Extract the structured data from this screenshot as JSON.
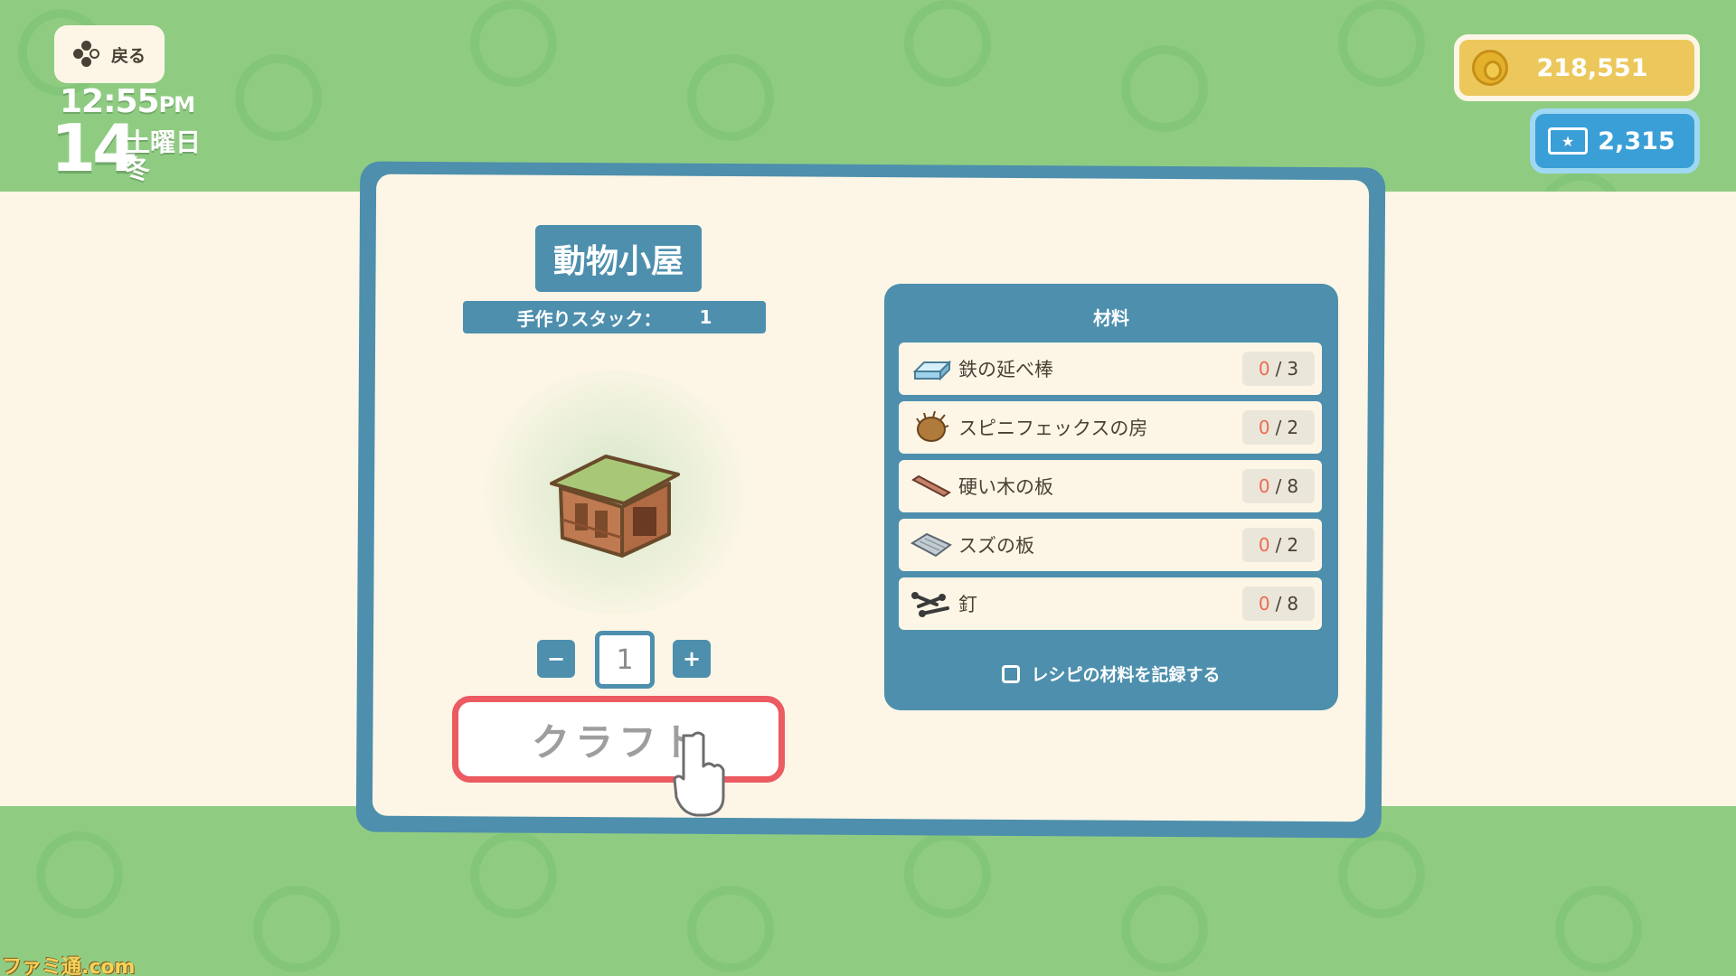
{
  "hud": {
    "back_label": "戻る",
    "time": "12:55",
    "time_suffix": "PM",
    "day_number": "14",
    "weekday": "土曜日",
    "season": "冬"
  },
  "currency": {
    "gold": "218,551",
    "tickets": "2,315"
  },
  "recipe": {
    "title": "動物小屋",
    "stack_label": "手作りスタック：",
    "stack_value": "1",
    "quantity": "1",
    "minus_label": "−",
    "plus_label": "+",
    "craft_label": "クラフト"
  },
  "materials": {
    "header": "材料",
    "items": [
      {
        "name": "鉄の延べ棒",
        "have": "0",
        "need": "3",
        "icon": "iron-bar-icon"
      },
      {
        "name": "スピニフェックスの房",
        "have": "0",
        "need": "2",
        "icon": "spinifex-tuft-icon"
      },
      {
        "name": "硬い木の板",
        "have": "0",
        "need": "8",
        "icon": "hardwood-plank-icon"
      },
      {
        "name": "スズの板",
        "have": "0",
        "need": "2",
        "icon": "tin-plate-icon"
      },
      {
        "name": "釘",
        "have": "0",
        "need": "8",
        "icon": "nails-icon"
      }
    ],
    "separator": "/",
    "record_label": "レシピの材料を記録する"
  },
  "watermark": "ファミ通.com",
  "colors": {
    "panel_blue": "#4d8fad",
    "cream": "#fdf6e6",
    "grass": "#8fcc82",
    "craft_border": "#ec5a62",
    "gold": "#ecc85c",
    "ticket_blue": "#3a9fd6",
    "shortage_red": "#ec6b4f"
  }
}
